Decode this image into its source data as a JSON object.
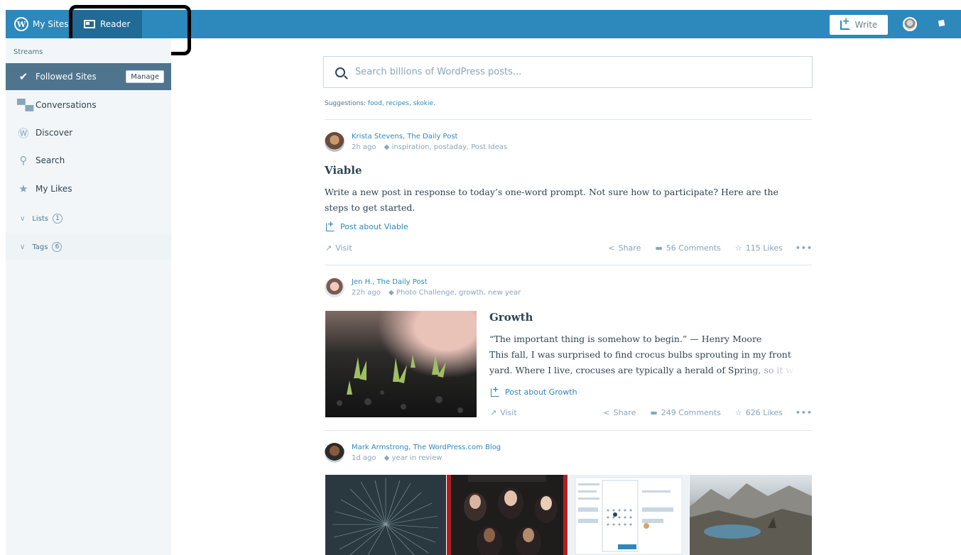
{
  "topbar": {
    "my_sites_label": "My Sites",
    "reader_label": "Reader",
    "write_label": "Write"
  },
  "sidebar": {
    "heading": "Streams",
    "items": [
      {
        "label": "Followed Sites",
        "icon": "check-circle-icon",
        "active": true,
        "action": "Manage"
      },
      {
        "label": "Conversations",
        "icon": "chat-bubbles-icon"
      },
      {
        "label": "Discover",
        "icon": "wordpress-icon"
      },
      {
        "label": "Search",
        "icon": "search-icon"
      },
      {
        "label": "My Likes",
        "icon": "star-icon"
      }
    ],
    "groups": [
      {
        "label": "Lists",
        "count": "1"
      },
      {
        "label": "Tags",
        "count": "6"
      }
    ]
  },
  "search": {
    "placeholder": "Search billions of WordPress posts..."
  },
  "suggestions": {
    "prefix": "Suggestions:",
    "items": [
      "food",
      "recipes",
      "skokie."
    ]
  },
  "posts": [
    {
      "author": "Krista Stevens, The Daily Post",
      "time": "2h ago",
      "tags": "inspiration, postaday, Post Ideas",
      "title": "Viable",
      "excerpt": "Write a new post in response to today’s one-word prompt. Not sure how to participate? Here are the steps to get started.",
      "action": "Post about Viable",
      "visit": "Visit",
      "share": "Share",
      "comments": "56 Comments",
      "likes": "115 Likes"
    },
    {
      "author": "Jen H., The Daily Post",
      "time": "22h ago",
      "tags": "Photo Challenge, growth, new year",
      "title": "Growth",
      "excerpt_line1": "“The important thing is somehow to begin.” — Henry Moore",
      "excerpt_line2": "This fall, I was surprised to find crocus bulbs sprouting in my front yard. Where I live, crocuses are typically a herald of Spring, so it w",
      "action": "Post about Growth",
      "visit": "Visit",
      "share": "Share",
      "comments": "249 Comments",
      "likes": "626 Likes"
    },
    {
      "author": "Mark Armstrong, The WordPress.com Blog",
      "time": "1d ago",
      "tags": "year in review"
    }
  ],
  "colors": {
    "masterbar": "#2d88bb",
    "reader_tab": "#206a95",
    "sidebar_bg": "#f3f6f8",
    "sidebar_active": "#4f748e",
    "link": "#2d88bb",
    "text": "#2e4453",
    "muted": "#87a6bc"
  }
}
